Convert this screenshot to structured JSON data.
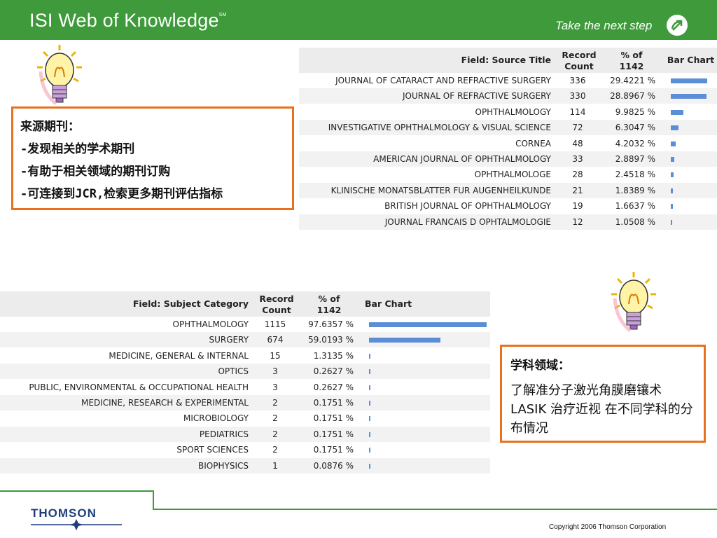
{
  "header": {
    "title": "ISI Web of Knowledge",
    "trademark": "SM",
    "tagline": "Take the next step"
  },
  "note_journals": {
    "lines": [
      "来源期刊：",
      "-发现相关的学术期刊",
      "-有助于相关领域的期刊订购",
      "-可连接到JCR,检索更多期刊评估指标"
    ]
  },
  "note_subjects": {
    "heading": "学科领域：",
    "body": "了解准分子激光角膜磨镶术 LASIK 治疗近视 在不同学科的分布情况"
  },
  "source_table": {
    "field_header": "Field: Source Title",
    "count_header_1": "Record",
    "count_header_2": "Count",
    "pct_header_1": "% of",
    "pct_header_2": "1142",
    "bar_header": "Bar Chart",
    "rows": [
      {
        "name": "JOURNAL OF CATARACT AND REFRACTIVE SURGERY",
        "count": "336",
        "pct": "29.4221 %",
        "value": 29.4221
      },
      {
        "name": "JOURNAL OF REFRACTIVE SURGERY",
        "count": "330",
        "pct": "28.8967 %",
        "value": 28.8967
      },
      {
        "name": "OPHTHALMOLOGY",
        "count": "114",
        "pct": "9.9825 %",
        "value": 9.9825
      },
      {
        "name": "INVESTIGATIVE OPHTHALMOLOGY & VISUAL SCIENCE",
        "count": "72",
        "pct": "6.3047 %",
        "value": 6.3047
      },
      {
        "name": "CORNEA",
        "count": "48",
        "pct": "4.2032 %",
        "value": 4.2032
      },
      {
        "name": "AMERICAN JOURNAL OF OPHTHALMOLOGY",
        "count": "33",
        "pct": "2.8897 %",
        "value": 2.8897
      },
      {
        "name": "OPHTHALMOLOGE",
        "count": "28",
        "pct": "2.4518 %",
        "value": 2.4518
      },
      {
        "name": "KLINISCHE MONATSBLATTER FUR AUGENHEILKUNDE",
        "count": "21",
        "pct": "1.8389 %",
        "value": 1.8389
      },
      {
        "name": "BRITISH JOURNAL OF OPHTHALMOLOGY",
        "count": "19",
        "pct": "1.6637 %",
        "value": 1.6637
      },
      {
        "name": "JOURNAL FRANCAIS D OPHTALMOLOGIE",
        "count": "12",
        "pct": "1.0508 %",
        "value": 1.0508
      }
    ]
  },
  "subject_table": {
    "field_header": "Field: Subject Category",
    "count_header_1": "Record",
    "count_header_2": "Count",
    "pct_header_1": "% of",
    "pct_header_2": "1142",
    "bar_header": "Bar Chart",
    "rows": [
      {
        "name": "OPHTHALMOLOGY",
        "count": "1115",
        "pct": "97.6357 %",
        "value": 97.6357
      },
      {
        "name": "SURGERY",
        "count": "674",
        "pct": "59.0193 %",
        "value": 59.0193
      },
      {
        "name": "MEDICINE, GENERAL & INTERNAL",
        "count": "15",
        "pct": "1.3135 %",
        "value": 1.3135
      },
      {
        "name": "OPTICS",
        "count": "3",
        "pct": "0.2627 %",
        "value": 0.2627
      },
      {
        "name": "PUBLIC, ENVIRONMENTAL & OCCUPATIONAL HEALTH",
        "count": "3",
        "pct": "0.2627 %",
        "value": 0.2627
      },
      {
        "name": "MEDICINE, RESEARCH & EXPERIMENTAL",
        "count": "2",
        "pct": "0.1751 %",
        "value": 0.1751
      },
      {
        "name": "MICROBIOLOGY",
        "count": "2",
        "pct": "0.1751 %",
        "value": 0.1751
      },
      {
        "name": "PEDIATRICS",
        "count": "2",
        "pct": "0.1751 %",
        "value": 0.1751
      },
      {
        "name": "SPORT SCIENCES",
        "count": "2",
        "pct": "0.1751 %",
        "value": 0.1751
      },
      {
        "name": "BIOPHYSICS",
        "count": "1",
        "pct": "0.0876 %",
        "value": 0.0876
      }
    ]
  },
  "footer": {
    "logo": "THOMSON",
    "copyright": "Copyright 2006 Thomson Corporation"
  },
  "colors": {
    "header_green": "#3e9a3a",
    "note_border": "#e8701e",
    "bar_blue": "#5b8ed6"
  }
}
